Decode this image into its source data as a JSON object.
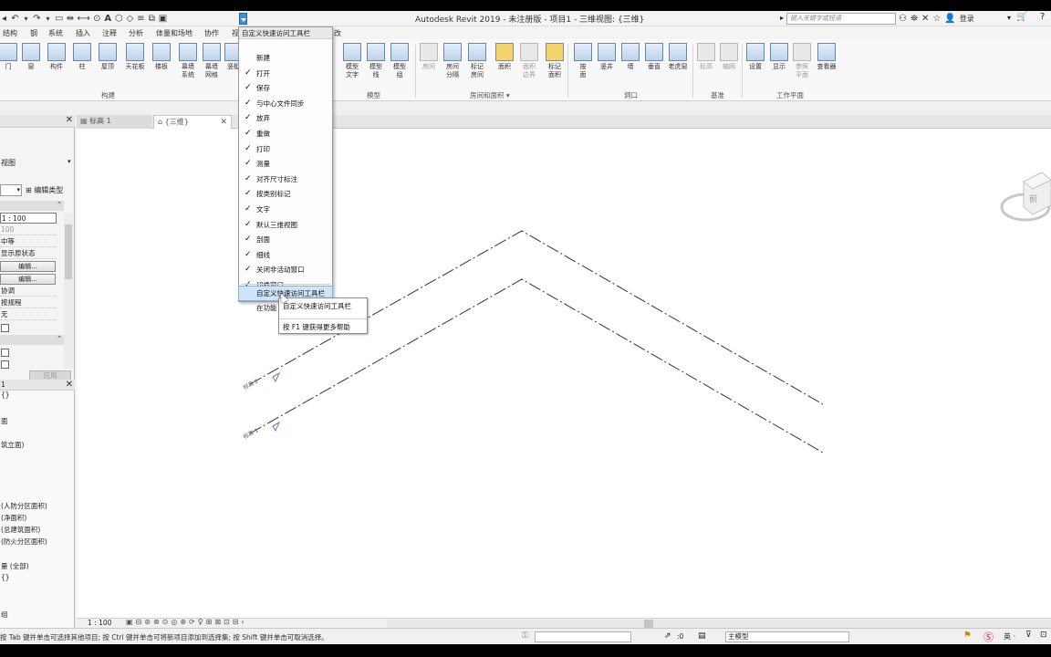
{
  "window": {
    "title": "Autodesk Revit 2019 - 未注册版 - 项目1 - 三维视图: {三维}",
    "search_placeholder": "键入关键字或短语",
    "login": "登录"
  },
  "menu_tabs": [
    "结构",
    "钢",
    "系统",
    "插入",
    "注释",
    "分析",
    "体量和场地",
    "协作",
    "视",
    "改"
  ],
  "ribbon": {
    "buttons_left": [
      {
        "label": "门",
        "icon": "door-icon"
      },
      {
        "label": "窗",
        "icon": "window-icon"
      },
      {
        "label": "构件",
        "icon": "component-icon"
      },
      {
        "label": "柱",
        "icon": "column-icon"
      },
      {
        "label": "屋顶",
        "icon": "roof-icon"
      },
      {
        "label": "天花板",
        "icon": "ceiling-icon"
      },
      {
        "label": "楼板",
        "icon": "floor-icon"
      },
      {
        "label": "幕墙\n系统",
        "icon": "curtain-system-icon"
      },
      {
        "label": "幕墙\n网格",
        "icon": "curtain-grid-icon"
      },
      {
        "label": "竖梃",
        "icon": "mullion-icon"
      }
    ],
    "buttons_right": [
      {
        "label": "模型\n文字",
        "icon": "model-text-icon"
      },
      {
        "label": "模型\n线",
        "icon": "model-line-icon"
      },
      {
        "label": "模型\n组",
        "icon": "model-group-icon"
      },
      {
        "label": "房间",
        "icon": "room-icon"
      },
      {
        "label": "房间\n分隔",
        "icon": "room-separator-icon"
      },
      {
        "label": "标记\n房间",
        "icon": "tag-room-icon"
      },
      {
        "label": "面积",
        "icon": "area-icon"
      },
      {
        "label": "面积\n边界",
        "icon": "area-boundary-icon"
      },
      {
        "label": "标记\n面积",
        "icon": "tag-area-icon"
      },
      {
        "label": "按\n面",
        "icon": "by-face-icon"
      },
      {
        "label": "竖井",
        "icon": "shaft-icon"
      },
      {
        "label": "墙",
        "icon": "wall-opening-icon"
      },
      {
        "label": "垂直",
        "icon": "vertical-icon"
      },
      {
        "label": "老虎窗",
        "icon": "dormer-icon"
      },
      {
        "label": "标高",
        "icon": "level-icon"
      },
      {
        "label": "轴网",
        "icon": "grid-icon"
      },
      {
        "label": "设置",
        "icon": "set-icon"
      },
      {
        "label": "显示",
        "icon": "show-icon"
      },
      {
        "label": "参照\n平面",
        "icon": "ref-plane-icon"
      },
      {
        "label": "查看器",
        "icon": "viewer-icon"
      }
    ],
    "panels": [
      "构建",
      "模型",
      "房间和面积",
      "洞口",
      "基准",
      "工作平面"
    ]
  },
  "view_tabs": [
    "标高 1",
    "{三维}"
  ],
  "properties": {
    "type_selector": "视图",
    "edit_type": "编辑类型",
    "rows": [
      "1 : 100",
      "100",
      "中等",
      "显示原状态",
      "编辑...",
      "编辑...",
      "协调",
      "按规程",
      "无"
    ],
    "apply": "应用"
  },
  "browser": {
    "items": [
      "1",
      "{}",
      "面",
      "筑立面)",
      "(人防分区面积)",
      "(净面积)",
      "(总建筑面积)",
      "(防火分区面积)",
      "量 (全部)",
      "{}",
      "组"
    ]
  },
  "view_control": {
    "scale": "1 : 100"
  },
  "status": {
    "text": "按 Tab 键并单击可选择其他项目; 按 Ctrl 键并单击可将新项目添加到选择集; 按 Shift 键并单击可取消选择。",
    "coord": ":0",
    "model": "主模型"
  },
  "dropdown": {
    "title": "自定义快速访问工具栏",
    "items": [
      {
        "label": "新建",
        "checked": false
      },
      {
        "label": "打开",
        "checked": true
      },
      {
        "label": "保存",
        "checked": true
      },
      {
        "label": "与中心文件同步",
        "checked": true
      },
      {
        "label": "放弃",
        "checked": true
      },
      {
        "label": "重做",
        "checked": true
      },
      {
        "label": "打印",
        "checked": true
      },
      {
        "label": "测量",
        "checked": true
      },
      {
        "label": "对齐尺寸标注",
        "checked": true
      },
      {
        "label": "按类别标记",
        "checked": true
      },
      {
        "label": "文字",
        "checked": true
      },
      {
        "label": "默认三维视图",
        "checked": true
      },
      {
        "label": "剖面",
        "checked": true
      },
      {
        "label": "细线",
        "checked": true
      },
      {
        "label": "关闭非活动窗口",
        "checked": true
      },
      {
        "label": "切换窗口",
        "checked": true
      }
    ],
    "custom_item": "自定义快速访问工具栏",
    "below_item": "在功能"
  },
  "tooltip": {
    "title": "自定义快速访问工具栏",
    "help": "按 F1 键获得更多帮助"
  },
  "levels": [
    "标高 2",
    "标高 1"
  ],
  "colors": {
    "accent": "#3e8fd9",
    "highlight": "#cde4fa"
  }
}
